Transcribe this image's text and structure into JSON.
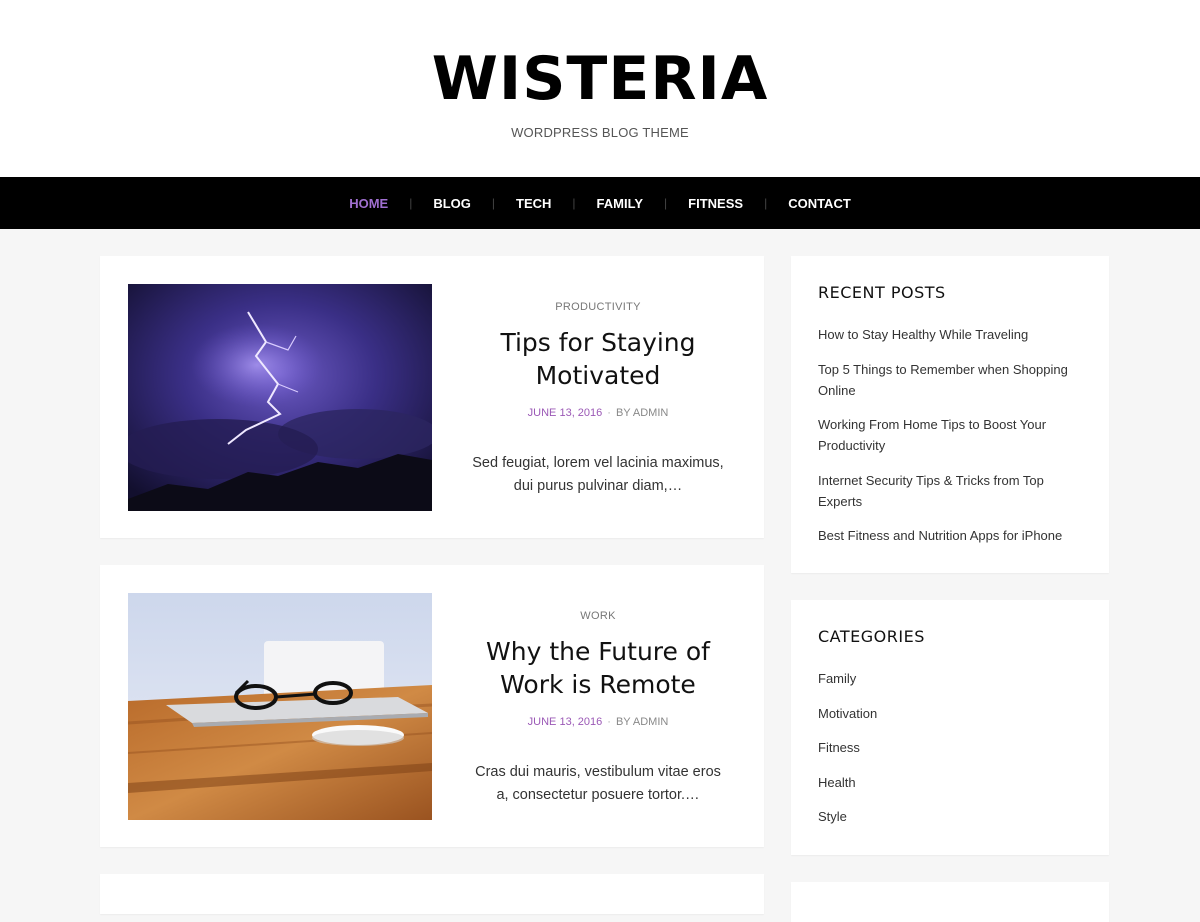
{
  "site": {
    "title": "WISTERIA",
    "tagline": "WORDPRESS BLOG THEME"
  },
  "nav": {
    "items": [
      "HOME",
      "BLOG",
      "TECH",
      "FAMILY",
      "FITNESS",
      "CONTACT"
    ],
    "active": "HOME",
    "active_color": "#a06fd0"
  },
  "posts": [
    {
      "category": "PRODUCTIVITY",
      "title": "Tips for Staying Motivated",
      "date": "JUNE 13, 2016",
      "separator": "·",
      "author": "BY ADMIN",
      "excerpt": "Sed feugiat, lorem vel lacinia maximus, dui purus pulvinar diam,…",
      "image": "lightning-storm-photo"
    },
    {
      "category": "WORK",
      "title": "Why the Future of Work is Remote",
      "date": "JUNE 13, 2016",
      "separator": "·",
      "author": "BY ADMIN",
      "excerpt": "Cras dui mauris, vestibulum vitae eros a, consectetur posuere tortor.…",
      "image": "desk-laptop-glasses-photo"
    }
  ],
  "sidebar": {
    "recent_posts": {
      "title": "RECENT POSTS",
      "items": [
        "How to Stay Healthy While Traveling",
        "Top 5 Things to Remember when Shopping Online",
        "Working From Home Tips to Boost Your Productivity",
        "Internet Security Tips & Tricks from Top Experts",
        "Best Fitness and Nutrition Apps for iPhone"
      ]
    },
    "categories": {
      "title": "CATEGORIES",
      "items": [
        "Family",
        "Motivation",
        "Fitness",
        "Health",
        "Style"
      ]
    }
  },
  "colors": {
    "accent": "#9b59b6",
    "nav_bg": "#000000",
    "page_bg": "#f6f6f6"
  }
}
